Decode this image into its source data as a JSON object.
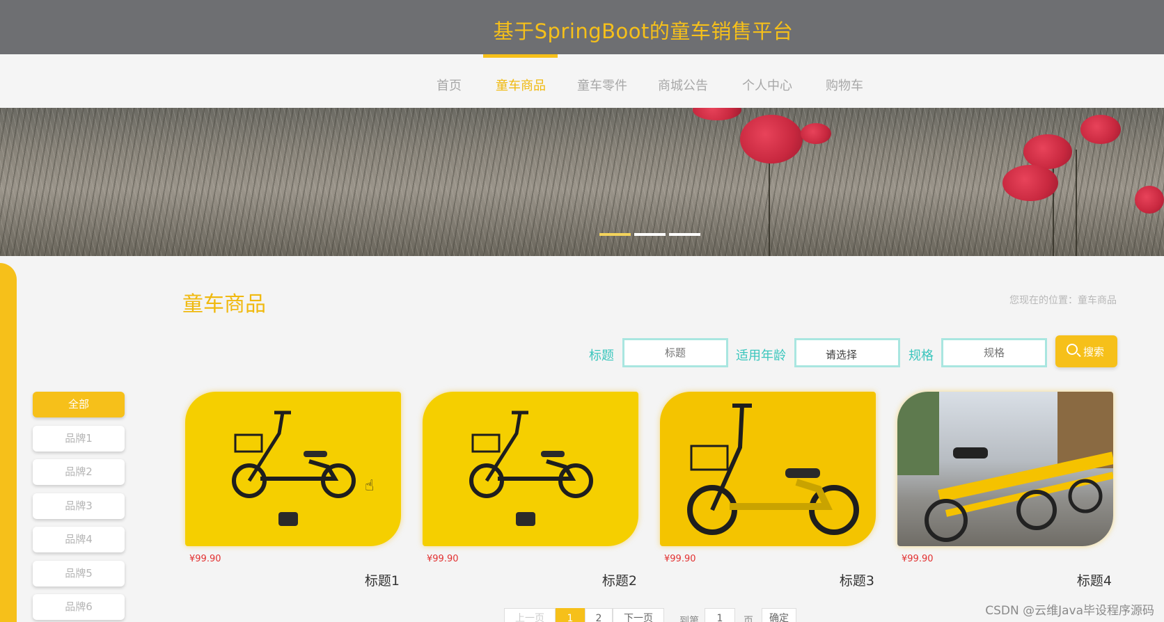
{
  "header": {
    "title": "基于SpringBoot的童车销售平台"
  },
  "nav": {
    "items": [
      {
        "label": "首页"
      },
      {
        "label": "童车商品"
      },
      {
        "label": "童车零件"
      },
      {
        "label": "商城公告"
      },
      {
        "label": "个人中心"
      },
      {
        "label": "购物车"
      }
    ],
    "active_index": 1
  },
  "banner": {
    "slide_count": 3,
    "active_slide": 1
  },
  "page": {
    "title": "童车商品",
    "breadcrumb": "您现在的位置：童车商品"
  },
  "filters": {
    "title_label": "标题",
    "title_placeholder": "标题",
    "age_label": "适用年龄",
    "age_select_value": "请选择",
    "spec_label": "规格",
    "spec_placeholder": "规格",
    "search_label": "搜索"
  },
  "categories": [
    {
      "label": "全部",
      "active": true
    },
    {
      "label": "品牌1",
      "active": false
    },
    {
      "label": "品牌2",
      "active": false
    },
    {
      "label": "品牌3",
      "active": false
    },
    {
      "label": "品牌4",
      "active": false
    },
    {
      "label": "品牌5",
      "active": false
    },
    {
      "label": "品牌6",
      "active": false
    }
  ],
  "products": [
    {
      "price": "¥99.90",
      "title": "标题1"
    },
    {
      "price": "¥99.90",
      "title": "标题2"
    },
    {
      "price": "¥99.90",
      "title": "标题3"
    },
    {
      "price": "¥99.90",
      "title": "标题4"
    }
  ],
  "pagination": {
    "prev": "上一页",
    "pages": [
      "1",
      "2"
    ],
    "current": "1",
    "next": "下一页",
    "goto_label": "到第",
    "goto_value": "1",
    "page_unit": "页",
    "confirm": "确定"
  },
  "watermark": "CSDN @云维Java毕设程序源码",
  "colors": {
    "accent": "#f6c01a",
    "header_bg": "#6e6f72",
    "filter_label": "#3bc6bd",
    "price": "#e23030"
  }
}
